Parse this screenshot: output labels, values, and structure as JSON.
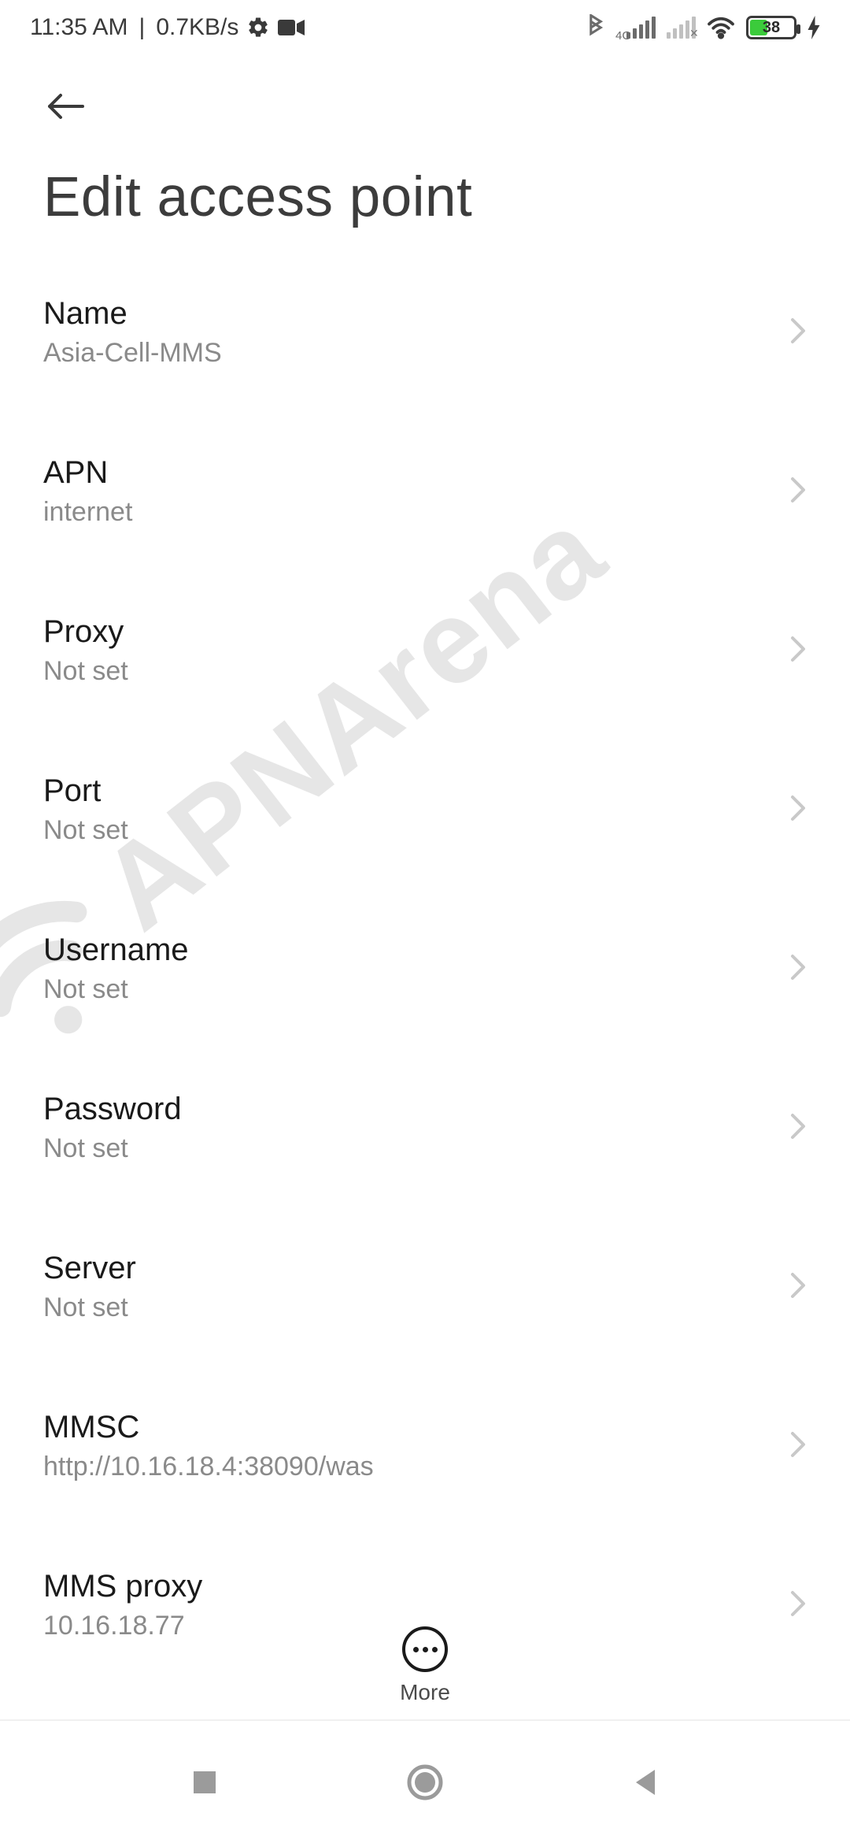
{
  "status": {
    "time": "11:35 AM",
    "data_rate": "0.7KB/s",
    "battery_percent": "38",
    "network_label": "4G"
  },
  "header": {
    "title": "Edit access point"
  },
  "settings": [
    {
      "label": "Name",
      "value": "Asia-Cell-MMS"
    },
    {
      "label": "APN",
      "value": "internet"
    },
    {
      "label": "Proxy",
      "value": "Not set"
    },
    {
      "label": "Port",
      "value": "Not set"
    },
    {
      "label": "Username",
      "value": "Not set"
    },
    {
      "label": "Password",
      "value": "Not set"
    },
    {
      "label": "Server",
      "value": "Not set"
    },
    {
      "label": "MMSC",
      "value": "http://10.16.18.4:38090/was"
    },
    {
      "label": "MMS proxy",
      "value": "10.16.18.77"
    }
  ],
  "float_action": {
    "label": "More"
  },
  "watermark": {
    "text": "APNArena"
  }
}
